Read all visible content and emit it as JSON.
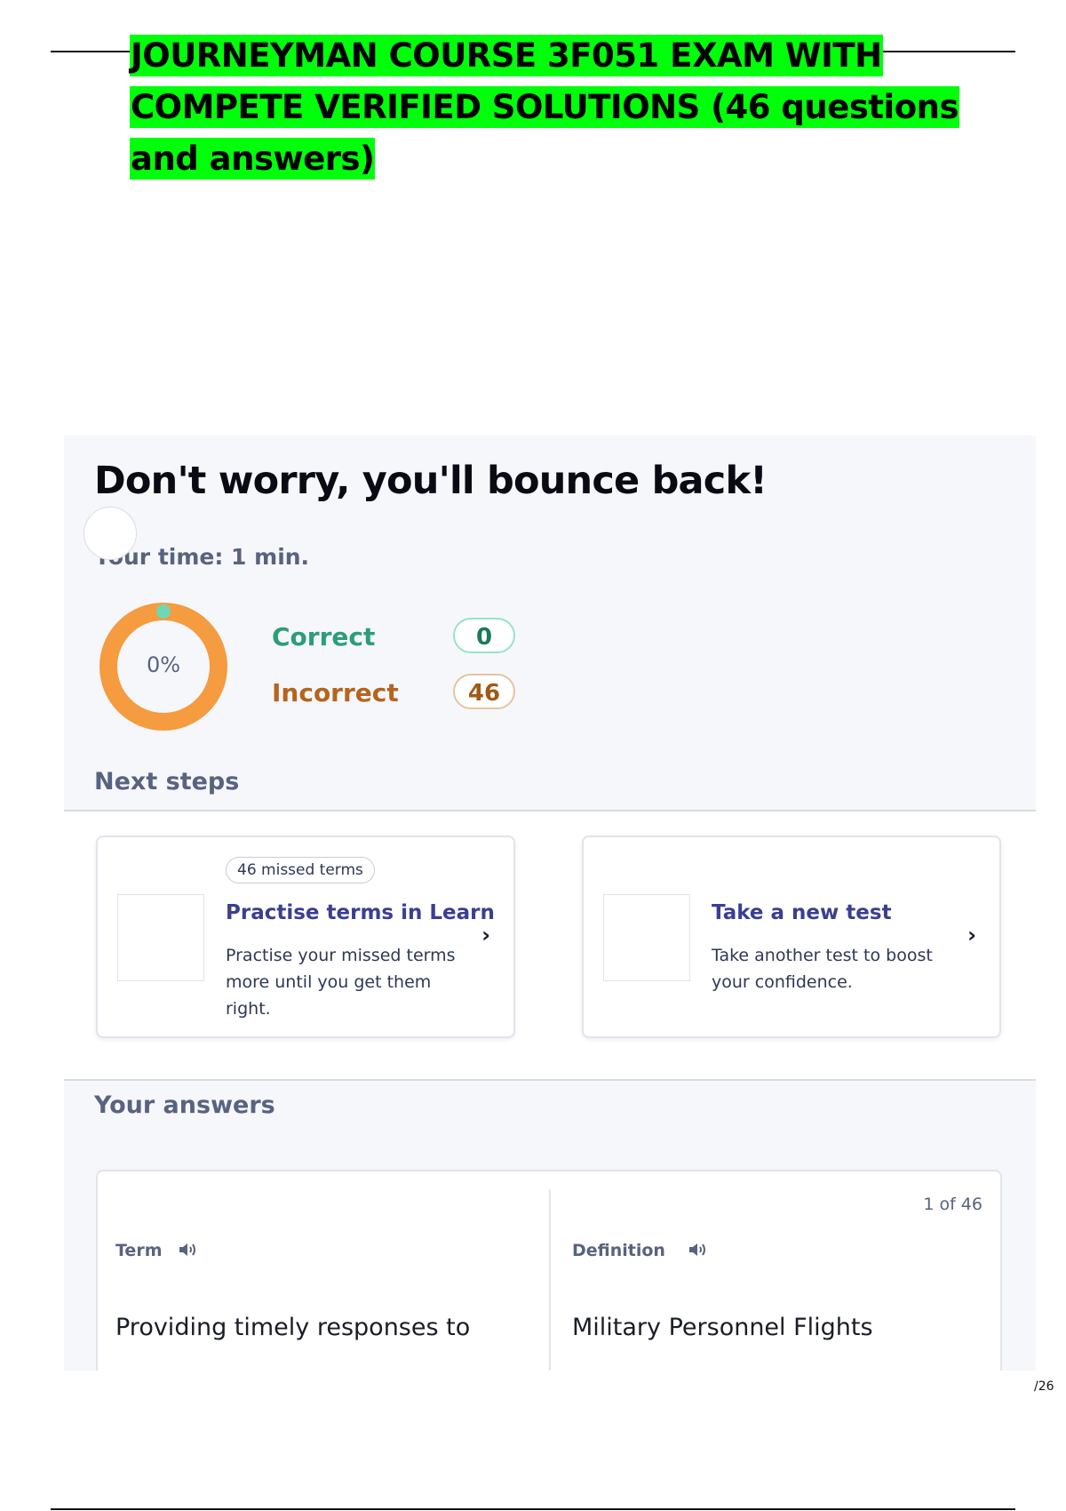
{
  "document": {
    "title": "JOURNEYMAN COURSE 3F051 EXAM WITH COMPETE VERIFIED SOLUTIONS (46 questions and answers)",
    "page_number": "/26"
  },
  "results": {
    "headline": "Don't worry, you'll bounce back!",
    "time_label": "Your time: 1 min.",
    "score_percent_label": "0%",
    "score_fraction": 0,
    "correct_label": "Correct",
    "correct_count": "0",
    "incorrect_label": "Incorrect",
    "incorrect_count": "46",
    "colors": {
      "correct": "#2d9d78",
      "incorrect": "#b5651d",
      "donut_ring": "#f49c3f",
      "donut_marker": "#6fd7b5"
    }
  },
  "next_steps": {
    "title": "Next steps",
    "cards": [
      {
        "badge": "46 missed terms",
        "title": "Practise terms in Learn",
        "description": "Practise your missed terms more until you get them right.",
        "icon": "chevron-right-icon"
      },
      {
        "title": "Take a new test",
        "description": "Take another test to boost your confidence.",
        "icon": "chevron-right-icon"
      }
    ]
  },
  "answers": {
    "title": "Your answers",
    "counter": "1 of 46",
    "term_label": "Term",
    "definition_label": "Definition",
    "term_text": "Providing timely responses to",
    "definition_text": "Military Personnel Flights",
    "audio_icon": "speaker-icon"
  }
}
